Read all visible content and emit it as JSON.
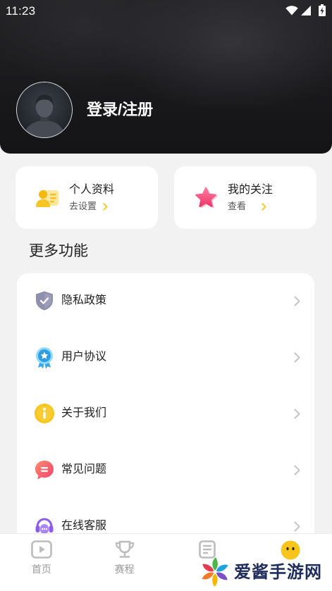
{
  "status_bar": {
    "time": "11:23",
    "icons": [
      "wifi-icon",
      "cellular-signal-icon",
      "battery-charging-icon"
    ]
  },
  "profile": {
    "avatar_icon": "default-avatar-icon",
    "login_label": "登录/注册"
  },
  "quick_cards": [
    {
      "title": "个人资料",
      "action": "去设置",
      "icon": "profile-card-icon"
    },
    {
      "title": "我的关注",
      "action": "查看",
      "icon": "star-icon"
    }
  ],
  "more_section": {
    "title": "更多功能"
  },
  "menu_items": [
    {
      "label": "隐私政策",
      "icon": "shield-check-icon"
    },
    {
      "label": "用户协议",
      "icon": "award-badge-icon"
    },
    {
      "label": "关于我们",
      "icon": "info-icon"
    },
    {
      "label": "常见问题",
      "icon": "faq-bubble-icon"
    },
    {
      "label": "在线客服",
      "icon": "headset-icon"
    }
  ],
  "bottom_nav": [
    {
      "label": "首页",
      "icon": "play-screen-icon",
      "active": false
    },
    {
      "label": "赛程",
      "icon": "trophy-icon",
      "active": false
    },
    {
      "icon": "document-icon",
      "active": false
    },
    {
      "icon": "smiley-face-icon",
      "active": true
    }
  ],
  "watermark": {
    "text": "爱酱手游网",
    "icon": "pinwheel-logo-icon"
  },
  "theme": {
    "header_bg": "#1b1b1e",
    "page_bg": "#f2f2f2",
    "accent_yellow": "#f5c518",
    "text_primary": "#222222",
    "text_secondary": "#555555",
    "nav_inactive": "#9a9a9a"
  }
}
